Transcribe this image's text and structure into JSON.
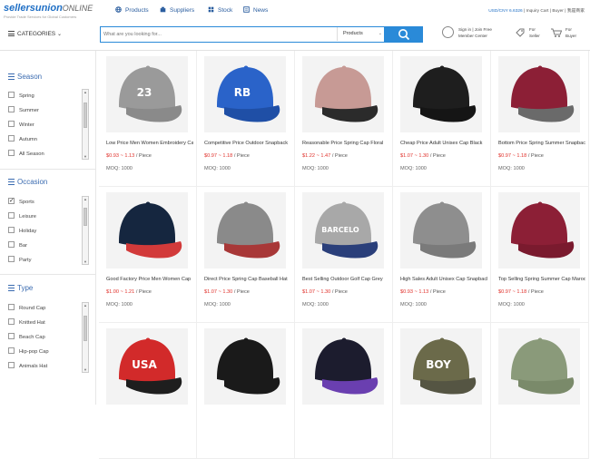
{
  "brand": {
    "name": "sellersunion",
    "suffix": "ONLINE",
    "tagline": "Provide Trade Services for Global Customers"
  },
  "nav": [
    {
      "label": "Products",
      "icon": "globe-icon"
    },
    {
      "label": "Suppliers",
      "icon": "suppliers-icon"
    },
    {
      "label": "Stock",
      "icon": "stock-grid-icon"
    },
    {
      "label": "News",
      "icon": "news-icon"
    }
  ],
  "toplinks": {
    "currency": "USD/CNY 6.6326",
    "inquiry": "Inquiry Cart",
    "buyer": "Buyer",
    "lang": "我是商家"
  },
  "categories_label": "CATEGORIES",
  "search": {
    "placeholder": "What are you looking for...",
    "scope": "Products"
  },
  "account": {
    "signin": "Sign in | Join Free",
    "member": "Member Center",
    "seller_line1": "For",
    "seller_line2": "Seller",
    "buyer_line1": "For",
    "buyer_line2": "Buyer"
  },
  "filters": {
    "season": {
      "title": "Season",
      "items": [
        "Spring",
        "Summer",
        "Winter",
        "Autumn",
        "All Season"
      ]
    },
    "occasion": {
      "title": "Occasion",
      "items": [
        "Sports",
        "Leisure",
        "Holiday",
        "Bar",
        "Party"
      ],
      "checked": [
        0
      ]
    },
    "type": {
      "title": "Type",
      "items": [
        "Round Cap",
        "Knitted Hat",
        "Beach Cap",
        "Hip-pop Cap",
        "Animals Hat"
      ]
    }
  },
  "products": [
    {
      "title": "Low Price Men Women Embroidery Cap",
      "price": "$0.93 ~ 1.13",
      "unit": " / Piece",
      "moq": "MOQ: 1000",
      "cap": "#9a9a9a",
      "brim": "#8a8a8a",
      "patch": "23"
    },
    {
      "title": "Competitive Price Outdoor Snapback",
      "price": "$0.97 ~ 1.18",
      "unit": " / Piece",
      "moq": "MOQ: 1000",
      "cap": "#2a63c9",
      "brim": "#1f4fa6",
      "patch": "RB"
    },
    {
      "title": "Reasonable Price Spring Cap Floral",
      "price": "$1.22 ~ 1.47",
      "unit": " / Piece",
      "moq": "MOQ: 1000",
      "cap": "#c79a95",
      "brim": "#2b2b2b",
      "patch": ""
    },
    {
      "title": "Cheap Price Adult Unisex Cap Black",
      "price": "$1.07 ~ 1.30",
      "unit": " / Piece",
      "moq": "MOQ: 1000",
      "cap": "#1e1e1e",
      "brim": "#151515",
      "patch": ""
    },
    {
      "title": "Bottom Price Spring Summer Snapback",
      "price": "$0.97 ~ 1.18",
      "unit": " / Piece",
      "moq": "MOQ: 1000",
      "cap": "#8c1f36",
      "brim": "#6a6a6a",
      "patch": ""
    },
    {
      "title": "Good Factory Price Men Women Cap",
      "price": "$1.00 ~ 1.21",
      "unit": " / Piece",
      "moq": "MOQ: 1000",
      "cap": "#15263f",
      "brim": "#d23a3a",
      "patch": ""
    },
    {
      "title": "Direct Price Spring Cap Baseball Hat",
      "price": "$1.07 ~ 1.30",
      "unit": " / Piece",
      "moq": "MOQ: 1000",
      "cap": "#8a8a8a",
      "brim": "#a83838",
      "patch": ""
    },
    {
      "title": "Best Selling Outdoor Golf Cap Grey",
      "price": "$1.07 ~ 1.30",
      "unit": " / Piece",
      "moq": "MOQ: 1000",
      "cap": "#a8a8a8",
      "brim": "#2a3f7a",
      "patch": "BARCELO"
    },
    {
      "title": "High Sales Adult Unisex Cap Snapback",
      "price": "$0.93 ~ 1.13",
      "unit": " / Piece",
      "moq": "MOQ: 1000",
      "cap": "#8e8e8e",
      "brim": "#7a7a7a",
      "patch": ""
    },
    {
      "title": "Top Selling Spring Summer Cap Maroon",
      "price": "$0.97 ~ 1.18",
      "unit": " / Piece",
      "moq": "MOQ: 1000",
      "cap": "#8c1f36",
      "brim": "#7a1a2e",
      "patch": ""
    },
    {
      "title": "",
      "price": "",
      "unit": "",
      "moq": "",
      "cap": "#d22a2a",
      "brim": "#1e1e1e",
      "patch": "USA"
    },
    {
      "title": "",
      "price": "",
      "unit": "",
      "moq": "",
      "cap": "#1a1a1a",
      "brim": "#1a1a1a",
      "patch": ""
    },
    {
      "title": "",
      "price": "",
      "unit": "",
      "moq": "",
      "cap": "#1c1c2e",
      "brim": "#6a3fb0",
      "patch": ""
    },
    {
      "title": "",
      "price": "",
      "unit": "",
      "moq": "",
      "cap": "#6b6a4a",
      "brim": "#555543",
      "patch": "BOY"
    },
    {
      "title": "",
      "price": "",
      "unit": "",
      "moq": "",
      "cap": "#8a9a7a",
      "brim": "#7a8a6a",
      "patch": ""
    }
  ],
  "colors": {
    "accent": "#2a8ad8",
    "price": "#e0302a",
    "link": "#2a5d9f"
  }
}
